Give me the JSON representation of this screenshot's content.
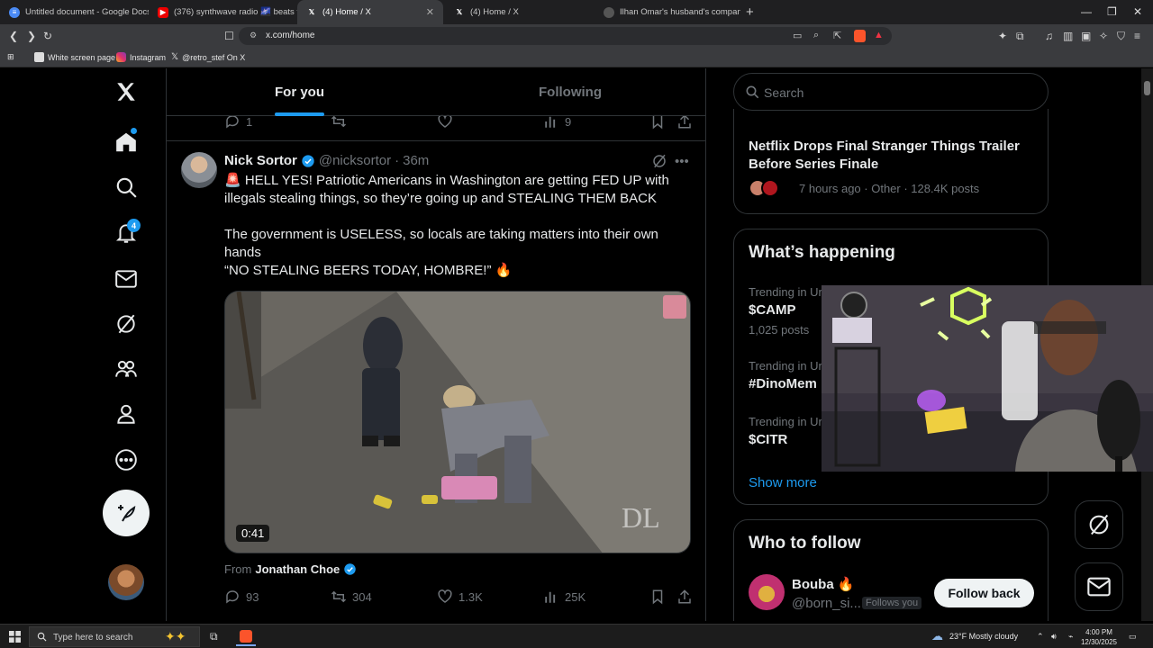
{
  "browser": {
    "tabs": [
      {
        "title": "Untitled document - Google Docs",
        "icon": "docs-icon",
        "active": false
      },
      {
        "title": "(376) synthwave radio 🌌 beats t",
        "icon": "youtube-icon",
        "active": false
      },
      {
        "title": "(4) Home / X",
        "icon": "x-icon",
        "active": true
      },
      {
        "title": "(4) Home / X",
        "icon": "x-icon",
        "active": false
      },
      {
        "title": "Ilhan Omar's husband's companies s",
        "icon": "web-icon",
        "active": false
      }
    ],
    "new_tab": "+",
    "url": "x.com/home",
    "bookmarks": [
      {
        "label": "White screen page",
        "icon": "page-icon"
      },
      {
        "label": "Instagram",
        "icon": "instagram-icon"
      },
      {
        "label": "@retro_stef On X",
        "icon": "x-icon"
      }
    ]
  },
  "nav": {
    "notifications_badge": "4",
    "items": [
      "x-logo-icon",
      "home-icon",
      "search-icon",
      "notifications-icon",
      "messages-icon",
      "grok-icon",
      "communities-icon",
      "profile-icon",
      "more-icon"
    ]
  },
  "feed": {
    "tabs": [
      "For you",
      "Following"
    ],
    "prev_tweet_stats": {
      "replies": "1",
      "reposts": "",
      "likes": "",
      "views": "9"
    },
    "tweet": {
      "name": "Nick Sortor",
      "handle": "@nicksortor",
      "dot": "·",
      "time": "36m",
      "line1": "🚨 HELL YES! Patriotic Americans in Washington are getting FED UP with illegals stealing things, so they’re going up and STEALING THEM BACK",
      "line2": "The government is USELESS, so locals are taking matters into their own hands",
      "line3": "“NO STEALING BEERS TODAY, HOMBRE!” 🔥",
      "video_duration": "0:41",
      "watermark": "DL",
      "from_label": "From",
      "from_name": "Jonathan Choe",
      "stats": {
        "replies": "93",
        "reposts": "304",
        "likes": "1.3K",
        "views": "25K"
      }
    }
  },
  "right": {
    "search_placeholder": "Search",
    "news": {
      "headline": "Netflix Drops Final Stranger Things Trailer Before Series Finale",
      "meta": "7 hours ago · Other · 128.4K posts"
    },
    "happening": {
      "title": "What’s happening",
      "trends": [
        {
          "context": "Trending in Ur",
          "name": "$CAMP",
          "count": "1,025 posts"
        },
        {
          "context": "Trending in Ur",
          "name": "#DinoMem",
          "count": ""
        },
        {
          "context": "Trending in Ur",
          "name": "$CITR",
          "count": ""
        }
      ],
      "show_more": "Show more"
    },
    "who_to_follow": {
      "title": "Who to follow",
      "name": "Bouba 🔥",
      "handle": "@born_si...",
      "follows_you": "Follows you",
      "button": "Follow back"
    }
  },
  "taskbar": {
    "search_placeholder": "Type here to search",
    "weather": "23°F  Mostly cloudy",
    "time": "4:00 PM",
    "date": "12/30/2025"
  },
  "colors": {
    "accent": "#1d9bf0",
    "background": "#000000",
    "muted": "#71767b",
    "border": "#2f3336"
  }
}
